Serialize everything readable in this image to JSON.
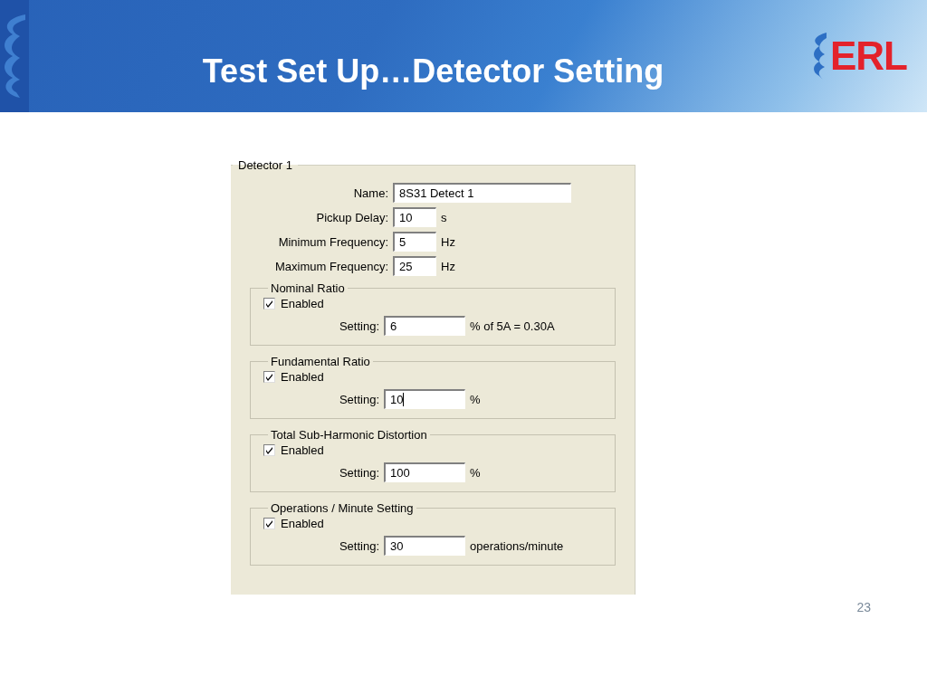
{
  "slide": {
    "title": "Test Set Up…Detector Setting",
    "logo": "ERL",
    "page_number": "23"
  },
  "dialog": {
    "group_title": "Detector 1",
    "fields": [
      {
        "kind": "wide",
        "label": "Name:",
        "value": "8S31 Detect 1"
      },
      {
        "kind": "short",
        "label": "Pickup Delay:",
        "value": "10",
        "unit": "s"
      },
      {
        "kind": "short",
        "label": "Minimum Frequency:",
        "value": "5",
        "unit": "Hz"
      },
      {
        "kind": "short",
        "label": "Maximum Frequency:",
        "value": "25",
        "unit": "Hz"
      }
    ],
    "sections": [
      {
        "title": "Nominal Ratio",
        "enabled_label": "Enabled",
        "checked": true,
        "setting_label": "Setting:",
        "value": "6",
        "unit": "% of 5A = 0.30A",
        "focused": false
      },
      {
        "title": "Fundamental Ratio",
        "enabled_label": "Enabled",
        "checked": true,
        "setting_label": "Setting:",
        "value": "10",
        "unit": "%",
        "focused": true
      },
      {
        "title": "Total Sub-Harmonic Distortion",
        "enabled_label": "Enabled",
        "checked": true,
        "setting_label": "Setting:",
        "value": "100",
        "unit": "%",
        "focused": false
      },
      {
        "title": "Operations / Minute Setting",
        "enabled_label": "Enabled",
        "checked": true,
        "setting_label": "Setting:",
        "value": "30",
        "unit": "operations/minute",
        "focused": false
      }
    ]
  }
}
